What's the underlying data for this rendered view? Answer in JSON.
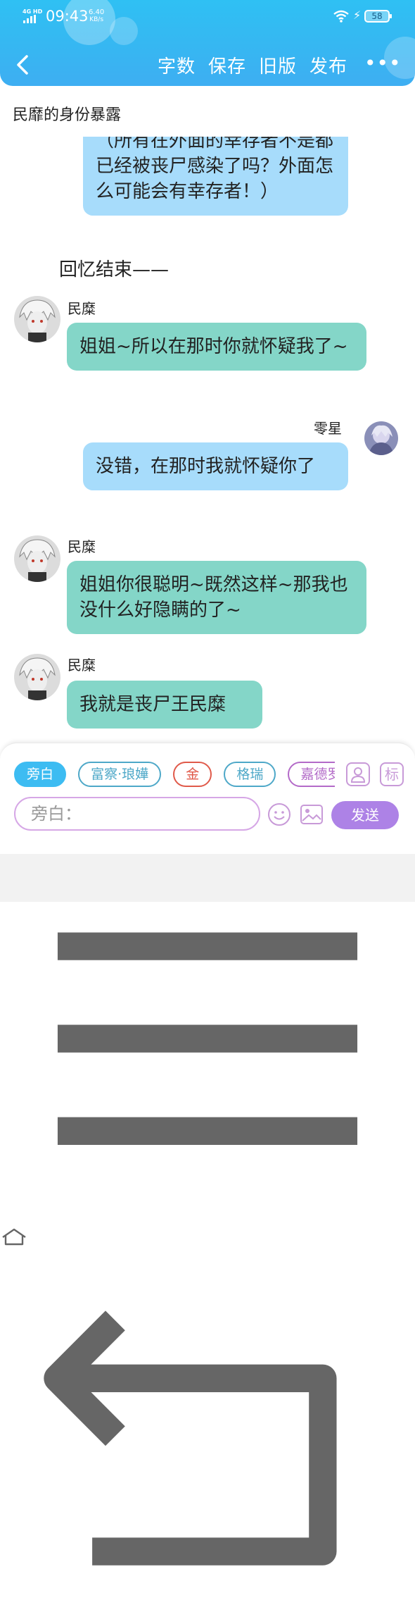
{
  "status": {
    "network": "4G HD",
    "time": "09:43",
    "speed_value": "6.40",
    "speed_unit": "KB/s",
    "battery": "58"
  },
  "header": {
    "actions": [
      "字数",
      "保存",
      "旧版",
      "发布"
    ],
    "more": "•••"
  },
  "chat_title": "民靡的身份暴露",
  "messages": [
    {
      "speaker": "",
      "text": "（所有在外面的幸存者不是都已经被丧尸感染了吗？外面怎么可能会有幸存者！）",
      "color": "#a7dcfb"
    },
    {
      "speaker": "",
      "text": "回忆结束——"
    },
    {
      "speaker": "民糜",
      "text": "姐姐~所以在那时你就怀疑我了~",
      "color": "#84d6c8"
    },
    {
      "speaker": "零星",
      "text": "没错，在那时我就怀疑你了",
      "color": "#a7dcfb"
    },
    {
      "speaker": "民糜",
      "text": "姐姐你很聪明~既然这样~那我也没什么好隐瞒的了~",
      "color": "#84d6c8"
    },
    {
      "speaker": "民糜",
      "text": "我就是丧尸王民糜",
      "color": "#84d6c8"
    }
  ],
  "input": {
    "chips": [
      "旁白",
      "富察·琅嬅",
      "金",
      "格瑞",
      "嘉德罗斯"
    ],
    "square_buttons": [
      "person-icon",
      "标"
    ],
    "placeholder": "旁白：",
    "send": "发送"
  },
  "colors": {
    "header": "#37b6f2",
    "accent": "#ad82e6",
    "blue_bubble": "#a7dcfb",
    "green_bubble": "#84d6c8"
  }
}
